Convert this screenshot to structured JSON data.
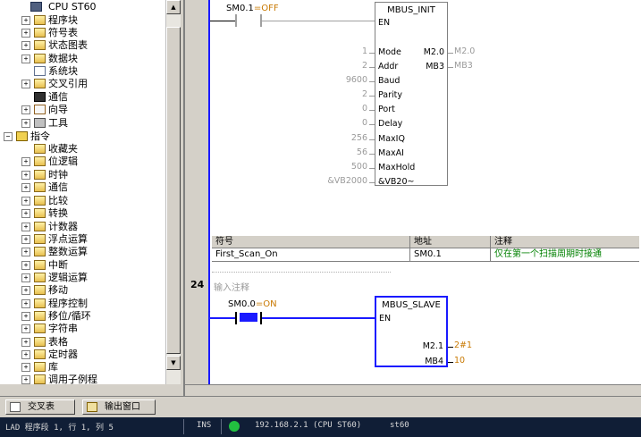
{
  "tree": {
    "items": [
      {
        "label": "CPU ST60",
        "icon": "cpu-icon",
        "expand": ""
      },
      {
        "label": "程序块",
        "icon": "folder-icon",
        "expand": "+"
      },
      {
        "label": "符号表",
        "icon": "folder-icon",
        "expand": "+"
      },
      {
        "label": "状态图表",
        "icon": "folder-icon",
        "expand": "+"
      },
      {
        "label": "数据块",
        "icon": "folder-icon",
        "expand": "+"
      },
      {
        "label": "系统块",
        "icon": "document-icon",
        "expand": ""
      },
      {
        "label": "交叉引用",
        "icon": "folder-icon",
        "expand": "+"
      },
      {
        "label": "通信",
        "icon": "computer-icon",
        "expand": ""
      },
      {
        "label": "向导",
        "icon": "wizard-icon",
        "expand": "+"
      },
      {
        "label": "工具",
        "icon": "tools-icon",
        "expand": "+"
      }
    ],
    "instructions_label": "指令",
    "instructions": [
      {
        "label": "收藏夹"
      },
      {
        "label": "位逻辑"
      },
      {
        "label": "时钟"
      },
      {
        "label": "通信"
      },
      {
        "label": "比较"
      },
      {
        "label": "转换"
      },
      {
        "label": "计数器"
      },
      {
        "label": "浮点运算"
      },
      {
        "label": "整数运算"
      },
      {
        "label": "中断"
      },
      {
        "label": "逻辑运算"
      },
      {
        "label": "移动"
      },
      {
        "label": "程序控制"
      },
      {
        "label": "移位/循环"
      },
      {
        "label": "字符串"
      },
      {
        "label": "表格"
      },
      {
        "label": "定时器"
      },
      {
        "label": "库"
      },
      {
        "label": "调用子例程"
      }
    ]
  },
  "network23": {
    "contact_label": "SM0.1",
    "contact_state": "=OFF",
    "box_title": "MBUS_INIT",
    "en": "EN",
    "inputs": [
      {
        "value": "1",
        "pin": "Mode"
      },
      {
        "value": "2",
        "pin": "Addr"
      },
      {
        "value": "9600",
        "pin": "Baud"
      },
      {
        "value": "2",
        "pin": "Parity"
      },
      {
        "value": "0",
        "pin": "Port"
      },
      {
        "value": "0",
        "pin": "Delay"
      },
      {
        "value": "256",
        "pin": "MaxIQ"
      },
      {
        "value": "56",
        "pin": "MaxAI"
      },
      {
        "value": "500",
        "pin": "MaxHold"
      },
      {
        "value": "&VB2000",
        "pin": "&VB20~"
      }
    ],
    "outputs": [
      {
        "pin": "M2.0",
        "value": "M2.0"
      },
      {
        "pin": "MB3",
        "value": "MB3"
      }
    ]
  },
  "symbol_table": {
    "headers": [
      "符号",
      "地址",
      "注释"
    ],
    "row": [
      "First_Scan_On",
      "SM0.1",
      "仅在第一个扫描周期时接通"
    ]
  },
  "network24": {
    "number": "24",
    "comment": "输入注释",
    "contact_label": "SM0.0",
    "contact_state": "=ON",
    "box_title": "MBUS_SLAVE",
    "en": "EN",
    "outputs": [
      {
        "pin": "M2.1",
        "value": "2#1"
      },
      {
        "pin": "MB4",
        "value": "10"
      }
    ]
  },
  "tabs": [
    {
      "label": "交叉表"
    },
    {
      "label": "输出窗口"
    }
  ],
  "status": {
    "position": "LAD 程序段 1, 行 1, 列 5",
    "mode": "INS",
    "connection": "192.168.2.1 (CPU ST60)",
    "cpu": "st60"
  },
  "colors": {
    "power_rail": "#1a1aff",
    "status_bar": "#101e36",
    "online_led": "#22c040",
    "value_orange": "#c87800",
    "comment_green": "#008000"
  }
}
